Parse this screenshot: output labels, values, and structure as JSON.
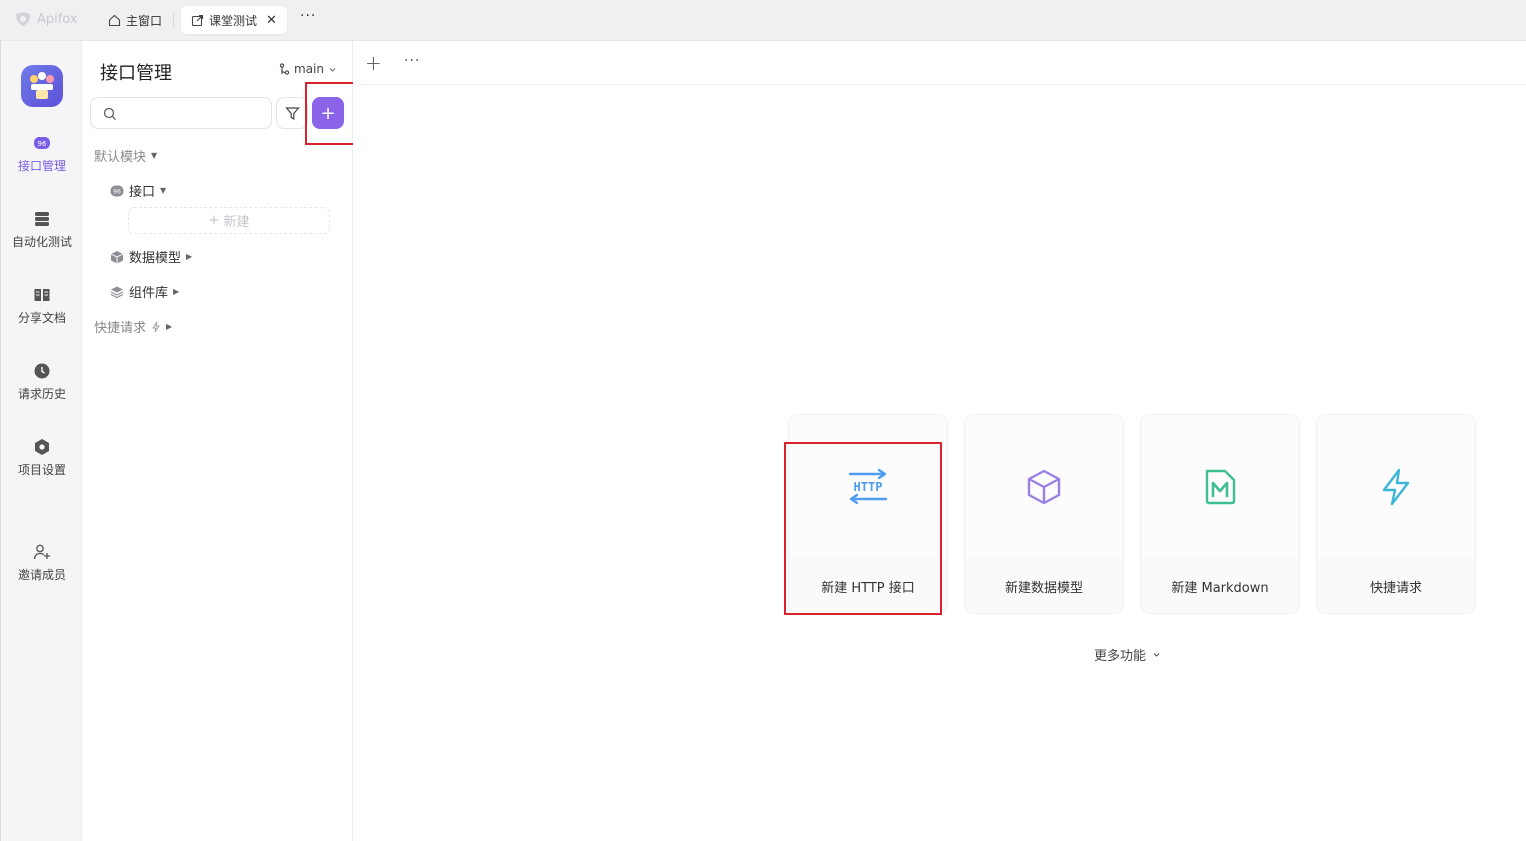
{
  "titlebar": {
    "app_name": "Apifox",
    "tabs": [
      {
        "label": "主窗口",
        "icon": "home-icon"
      },
      {
        "label": "课堂测试",
        "icon": "external-link-icon",
        "close": "✕"
      }
    ],
    "more": "···"
  },
  "rail": {
    "items": [
      {
        "label": "接口管理",
        "icon": "api-icon",
        "active": true
      },
      {
        "label": "自动化测试",
        "icon": "automation-icon"
      },
      {
        "label": "分享文档",
        "icon": "book-icon"
      },
      {
        "label": "请求历史",
        "icon": "clock-icon"
      },
      {
        "label": "项目设置",
        "icon": "settings-hex-icon"
      },
      {
        "label": "邀请成员",
        "icon": "add-user-icon"
      }
    ],
    "accent": "#7b5ce6"
  },
  "sidebar": {
    "title": "接口管理",
    "branch": "main",
    "search_placeholder": "",
    "add_label": "+",
    "tree": {
      "default_module": "默认模块",
      "api": "接口",
      "new_label": "新建",
      "data_model": "数据模型",
      "components": "组件库",
      "quick_request": "快捷请求"
    }
  },
  "main": {
    "add_tab": "+",
    "more": "···",
    "cards": [
      {
        "label": "新建 HTTP 接口",
        "icon": "http-icon",
        "color": "#4e9df0"
      },
      {
        "label": "新建数据模型",
        "icon": "cube-icon",
        "color": "#9b7fe6"
      },
      {
        "label": "新建 Markdown",
        "icon": "markdown-icon",
        "color": "#3fbf8f"
      },
      {
        "label": "快捷请求",
        "icon": "lightning-icon",
        "color": "#3db5d8"
      }
    ],
    "more_features": "更多功能"
  },
  "colors": {
    "primary_purple": "#8a63e8",
    "highlight_red": "#d9232f"
  }
}
